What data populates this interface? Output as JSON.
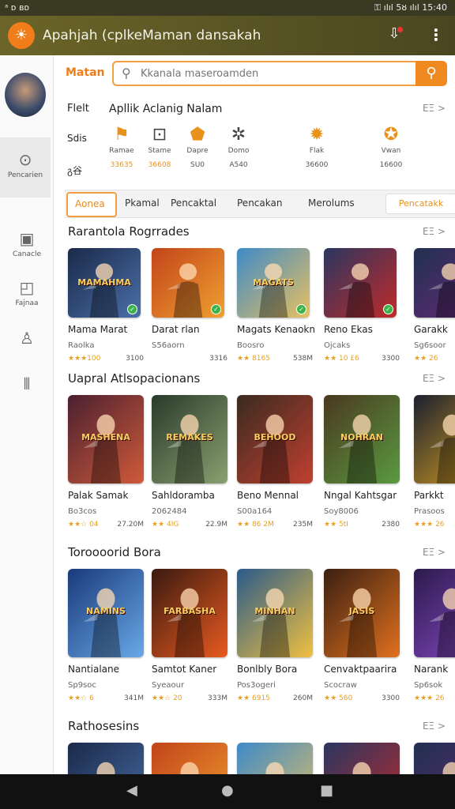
{
  "status": {
    "left": "ᵃ ᴅ ʙᴅ",
    "right": "⚿ ılıl 5ȣ ılıl 15:40"
  },
  "appbar": {
    "title": "Apahjah (cplkeMaman dansakah",
    "logo_icon": "orange-sun-logo",
    "cart_icon": "download-icon",
    "menu_icon": "more-vert-icon"
  },
  "sidebar": {
    "items": [
      {
        "label": "Pencarien",
        "icon": "compass-icon"
      },
      {
        "label": "Canacle",
        "icon": "image-icon"
      },
      {
        "label": "Fajnaa",
        "icon": "chat-icon"
      },
      {
        "label": "",
        "icon": "person-icon"
      },
      {
        "label": "",
        "icon": "chart-icon"
      }
    ]
  },
  "search": {
    "label": "Matan",
    "placeholder": "Kkanala maseroamden"
  },
  "row1": {
    "label": "Flelt",
    "title": "Apllik Aclanig Nalam",
    "more": "ΕΞ >"
  },
  "stats_labels": {
    "a": "Sdis",
    "b": "გ谷"
  },
  "stats": [
    {
      "label": "Ramae",
      "value": "33635"
    },
    {
      "label": "Stame",
      "value": "36608"
    },
    {
      "label": "Dapre",
      "value": "SU0"
    },
    {
      "label": "Domo",
      "value": "A540"
    },
    {
      "label": "Flak",
      "value": "36600"
    },
    {
      "label": "Vwan",
      "value": "16600"
    }
  ],
  "tabs": [
    "Aonea",
    "Pkamal",
    "Pencaktal",
    "Pencakan",
    "Merolums"
  ],
  "tab_button": "Pencatakk",
  "sections": [
    {
      "title": "Rarantola Rogrrades",
      "more": "ΕΞ >",
      "cards": [
        {
          "name": "Mama Marat",
          "sub": "Raolka",
          "rating": "★★★100",
          "size": "3100"
        },
        {
          "name": "Darat rlan",
          "sub": "S56aorn",
          "rating": "",
          "size": "3316"
        },
        {
          "name": "Magats Kenaokn",
          "sub": "Boosro",
          "rating": "★★ 8165",
          "size": "538M"
        },
        {
          "name": "Reno Ekas",
          "sub": "Ojcaks",
          "rating": "★★ 10 £6",
          "size": "3300"
        },
        {
          "name": "Garakk",
          "sub": "Sg6soor",
          "rating": "★★ 26",
          "size": ""
        }
      ]
    },
    {
      "title": "Uapral Atlsopacionans",
      "more": "ΕΞ >",
      "cards": [
        {
          "name": "Palak Samak",
          "sub": "Bo3cos",
          "rating": "★★☆ 04",
          "size": "27.20M"
        },
        {
          "name": "Sahldoramba",
          "sub": "2062484",
          "rating": "★★ 4IG",
          "size": "22.9M"
        },
        {
          "name": "Beno Mennal",
          "sub": "S00a164",
          "rating": "★★ 86 2M",
          "size": "235M"
        },
        {
          "name": "Nngal Kahtsgar",
          "sub": "Soy8006",
          "rating": "★★ 5tI",
          "size": "2380"
        },
        {
          "name": "Parkkt",
          "sub": "Prasoos",
          "rating": "★★★ 26",
          "size": ""
        }
      ]
    },
    {
      "title": "Toroooorid Bora",
      "more": "ΕΞ >",
      "cards": [
        {
          "name": "Nantialane",
          "sub": "Sp9soc",
          "rating": "★★☆ 6",
          "size": "341M"
        },
        {
          "name": "Samtot Kaner",
          "sub": "Syeaour",
          "rating": "★★☆ 20",
          "size": "333M"
        },
        {
          "name": "Bonlbly Bora",
          "sub": "Pos3ogeri",
          "rating": "★★ 6915",
          "size": "260M"
        },
        {
          "name": "Cenvaktpaarira",
          "sub": "Scocraw",
          "rating": "★★ 560",
          "size": "3300"
        },
        {
          "name": "Narank",
          "sub": "Sp6sok",
          "rating": "★★★ 26",
          "size": ""
        }
      ]
    },
    {
      "title": "Rathosesins",
      "more": "ΕΞ >",
      "cards": []
    }
  ],
  "art_text": [
    "MAMAHMA",
    "",
    "MAGATS",
    "",
    "",
    "MASHENA",
    "REMAKES",
    "BEHOOD",
    "NOHRAN",
    "",
    "NAMINS",
    "FARBASHA",
    "MINHAN",
    "JASIS",
    ""
  ],
  "colors": {
    "accent": "#f07d1a",
    "appbar": "#5c5826",
    "rating": "#e8a020"
  }
}
